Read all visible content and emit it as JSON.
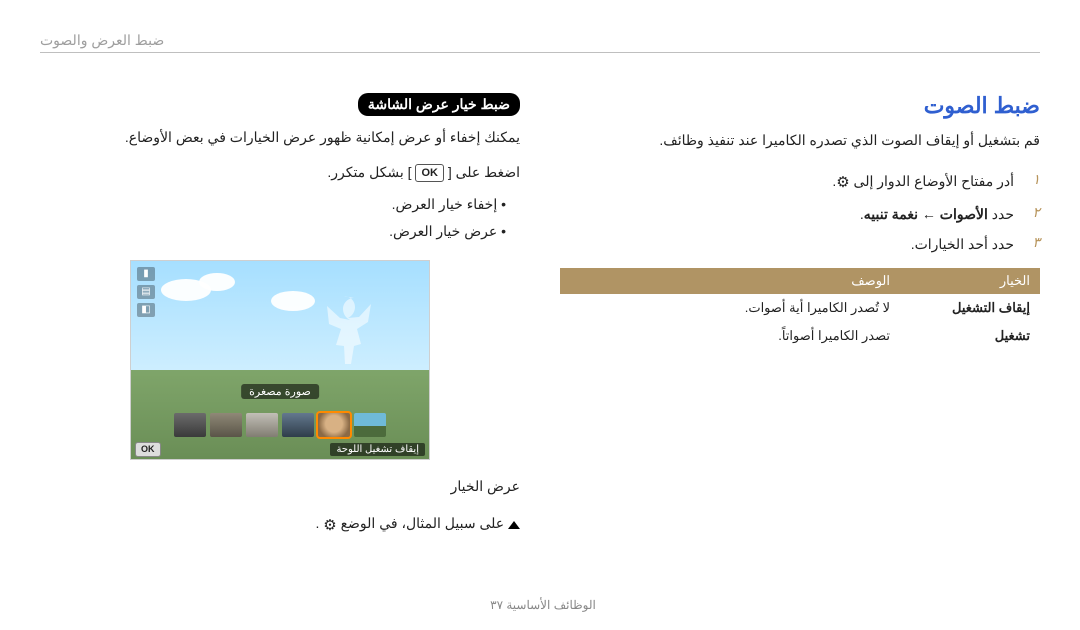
{
  "header": {
    "breadcrumb": "ضبط العرض والصوت"
  },
  "right": {
    "title": "ضبط خيار عرض الشاشة",
    "desc": "يمكنك إخفاء أو عرض إمكانية ظهور عرض الخيارات في بعض الأوضاع.",
    "press_part1": "اضغط على [",
    "ok_label": "OK",
    "press_part2": "] بشكل متكرر.",
    "bullets": [
      "إخفاء خيار العرض.",
      "عرض خيار العرض."
    ],
    "preview": {
      "thumb_label": "صورة مصغرة",
      "bottom_label": "إيقاف تشغيل اللوحة"
    },
    "callout": "عرض الخيار",
    "example_part1": " على سبيل المثال، في الوضع "
  },
  "left": {
    "title": "ضبط الصوت",
    "desc": "قم بتشغيل أو إيقاف الصوت الذي تصدره الكاميرا عند تنفيذ وظائف.",
    "steps": [
      {
        "n": "١",
        "text": "أدر مفتاح الأوضاع الدوار إلى "
      },
      {
        "n": "٢",
        "a": "حدد ",
        "b": "الأصوات",
        "arrow": " ← ",
        "c": "نغمة تنبيه"
      },
      {
        "n": "٣",
        "text": "حدد أحد الخيارات."
      }
    ],
    "table": {
      "headers": [
        "الخيار",
        "الوصف"
      ],
      "rows": [
        {
          "k": "إيقاف التشغيل",
          "v": "لا تُصدر الكاميرا أية أصوات."
        },
        {
          "k": "تشغيل",
          "v": "تصدر الكاميرا أصواتاً."
        }
      ]
    }
  },
  "footer": {
    "section": "الوظائف الأساسية",
    "page": "٣٧"
  }
}
